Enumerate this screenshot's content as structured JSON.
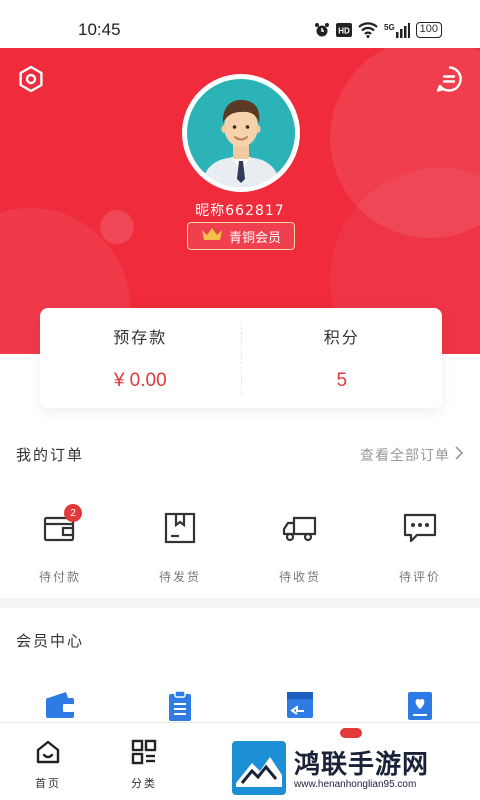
{
  "status_bar": {
    "time": "10:45",
    "battery": "100",
    "network": "5G"
  },
  "profile": {
    "nickname": "昵称662817",
    "member_level": "青铜会员"
  },
  "balance": {
    "deposit_label": "预存款",
    "deposit_value": "¥ 0.00",
    "points_label": "积分",
    "points_value": "5"
  },
  "orders": {
    "title": "我的订单",
    "view_all": "查看全部订单",
    "items": [
      {
        "label": "待付款",
        "icon": "wallet-icon",
        "badge": "2"
      },
      {
        "label": "待发货",
        "icon": "package-icon"
      },
      {
        "label": "待收货",
        "icon": "truck-icon"
      },
      {
        "label": "待评价",
        "icon": "comment-icon"
      }
    ]
  },
  "vip": {
    "title": "会员中心",
    "items": [
      {
        "icon": "wallet-icon"
      },
      {
        "icon": "clipboard-icon"
      },
      {
        "icon": "return-icon"
      },
      {
        "icon": "favorite-icon"
      }
    ]
  },
  "nav": {
    "home": "首页",
    "category": "分类"
  },
  "watermark": {
    "name": "鸿联手游网",
    "url": "www.henanhonglian95.com"
  },
  "colors": {
    "primary_red": "#ef2b3c",
    "price_red": "#e23a3a",
    "icon_blue": "#2f7be5"
  }
}
